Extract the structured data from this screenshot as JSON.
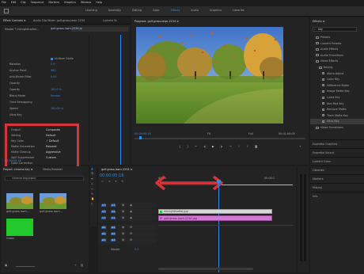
{
  "menu": [
    "File",
    "Edit",
    "Clip",
    "Sequence",
    "Markers",
    "Graphics",
    "Window",
    "Help"
  ],
  "workspaces": [
    "Learning",
    "Assembly",
    "Editing",
    "Color",
    "Effects",
    "Audio",
    "Graphics",
    "Libraries"
  ],
  "active_workspace": "Effects",
  "effect_controls": {
    "tabs": [
      "Effect Controls ≡",
      "Audio Clip Mixer: golf-grass-lawn-2234",
      "Lumetri Sc"
    ],
    "master": "Master * mknightluefiai...",
    "clip": "golf-grass-lawn-2234.jp",
    "uniform_scale": "Uniform Scale",
    "rows": [
      {
        "label": "Rotation",
        "value": "0.0"
      },
      {
        "label": "Anchor Point",
        "value": "960"
      },
      {
        "label": "Anti-flicker Filter",
        "value": "0.00"
      },
      {
        "label": "Opacity",
        "value": ""
      },
      {
        "label": "Opacity",
        "value": "100.0 %"
      },
      {
        "label": "Blend Mode",
        "value": "Normal"
      },
      {
        "label": "Time Remapping",
        "value": ""
      },
      {
        "label": "Speed",
        "value": "100.00 %"
      },
      {
        "label": "Ultra Key",
        "value": ""
      }
    ],
    "key_rows": [
      {
        "label": "Output",
        "value": "Composite"
      },
      {
        "label": "Setting",
        "value": "Default"
      },
      {
        "label": "Key Color",
        "value": "✓ Default"
      },
      {
        "label": "Matte Generation",
        "value": "Relaxed"
      },
      {
        "label": "Matte Cleanup",
        "value": "Aggressive"
      },
      {
        "label": "Spill Suppression",
        "value": "Custom"
      },
      {
        "label": "Color Correction",
        "value": ""
      }
    ],
    "timecode": "00:00:05:16"
  },
  "program": {
    "title": "Program: golf-grass-lawn-2234 ≡",
    "timecode": "00:00:05:16",
    "fit": "Fit",
    "full": "Full",
    "duration": "00:01:00:00"
  },
  "effects_panel": {
    "title": "Effects ≡",
    "search": "key",
    "items": [
      {
        "label": "Presets",
        "indent": 1,
        "folder": true
      },
      {
        "label": "Lumetri Presets",
        "indent": 1,
        "folder": true
      },
      {
        "label": "Audio Effects",
        "indent": 1,
        "folder": true
      },
      {
        "label": "Audio Transitions",
        "indent": 1,
        "folder": true
      },
      {
        "label": "Video Effects",
        "indent": 1,
        "folder": true
      },
      {
        "label": "Keying",
        "indent": 2,
        "folder": true
      },
      {
        "label": "Alpha Adjust",
        "indent": 3,
        "folder": false
      },
      {
        "label": "Color Key",
        "indent": 3,
        "folder": false
      },
      {
        "label": "Difference Matte",
        "indent": 3,
        "folder": false
      },
      {
        "label": "Image Matte Key",
        "indent": 3,
        "folder": false
      },
      {
        "label": "Luma Key",
        "indent": 3,
        "folder": false
      },
      {
        "label": "Non Red Key",
        "indent": 3,
        "folder": false
      },
      {
        "label": "Remove Matte",
        "indent": 3,
        "folder": false
      },
      {
        "label": "Track Matte Key",
        "indent": 3,
        "folder": false
      },
      {
        "label": "Ultra Key",
        "indent": 3,
        "folder": false,
        "selected": true
      },
      {
        "label": "Video Transitions",
        "indent": 1,
        "folder": true
      }
    ],
    "sections": [
      "Essential Graphics",
      "Essential Sound",
      "Lumetri Color",
      "Libraries",
      "Markers",
      "History",
      "Info"
    ]
  },
  "project": {
    "tabs": [
      "Project: chroma key ≡",
      "Media Browser"
    ],
    "search_placeholder": "chroma key.prproj",
    "items": [
      {
        "label": "golf-grass-lawn...",
        "duration": "5:00"
      },
      {
        "label": "golf-grass-lawn...",
        "duration": "5:00"
      },
      {
        "label": "Green",
        "duration": "5:00"
      }
    ]
  },
  "timeline": {
    "tab": "golf-grass-lawn-2234 ≡",
    "timecode": "00:00:05:16",
    "ruler_start": "00:00",
    "ruler_end": "00:00:1",
    "tracks_v": [
      "V3",
      "V2",
      "V1"
    ],
    "tracks_a": [
      "A1",
      "A2",
      "A3"
    ],
    "master": "Master",
    "master_val": "0.0",
    "clip_upper": "mknightluefiai.jpg",
    "clip_lower": "golf-grass-lawn-2234.jpg"
  },
  "colors": {
    "accent": "#2d8ceb",
    "highlight_box": "#d9343a",
    "clip_green": "#5fb05f",
    "clip_pink": "#d579d6"
  }
}
